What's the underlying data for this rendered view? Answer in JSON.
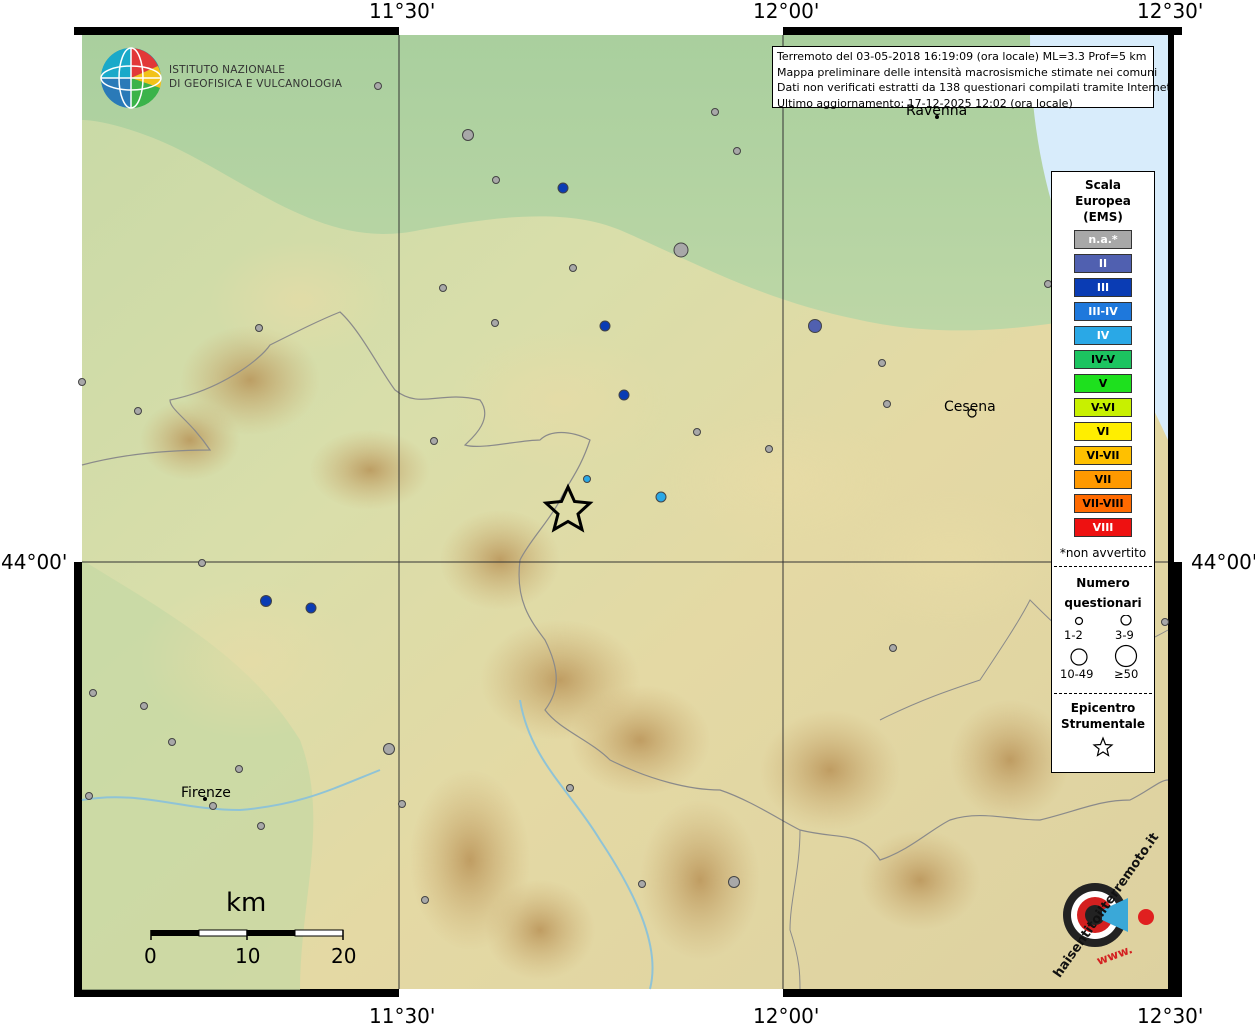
{
  "colors": {
    "border": "#000000",
    "grid": "#222222",
    "na": "#a8a8a8",
    "II": "#5060b0",
    "III": "#0a3cb4",
    "III_IV": "#1e78dc",
    "IV": "#2aa8e6",
    "IV_V": "#1cc460",
    "V": "#1ee01e",
    "V_VI": "#c8f000",
    "VI": "#ffee00",
    "VI_VII": "#ffc000",
    "VII": "#ff9900",
    "VII_VIII": "#ff6a00",
    "VIII": "#ee1111",
    "sea": "#d8ecfb"
  },
  "axes": {
    "top": [
      "11°30'",
      "12°00'",
      "12°30'"
    ],
    "bottom": [
      "11°30'",
      "12°00'",
      "12°30'"
    ],
    "left": "44°00'",
    "right": "44°00'"
  },
  "institute": {
    "line1": "ISTITUTO NAZIONALE",
    "line2": "DI GEOFISICA E VULCANOLOGIA",
    "logo_icon": "ingv-globe-icon"
  },
  "info": {
    "line1": "Terremoto del 03-05-2018 16:19:09 (ora locale) ML=3.3 Prof=5 km",
    "line2": "Mappa preliminare delle intensità macrosismiche stimate nei comuni",
    "line3": "Dati non verificati estratti da 138 questionari compilati tramite Internet.",
    "line4": "Ultimo aggiornamento: 17-12-2025 12:02 (ora locale)"
  },
  "legend": {
    "title1": "Scala",
    "title2": "Europea",
    "title3": "(EMS)",
    "classes": [
      {
        "label": "n.a.*",
        "color": "#a8a8a8",
        "dark": false
      },
      {
        "label": "II",
        "color": "#5060b0",
        "dark": false
      },
      {
        "label": "III",
        "color": "#0a3cb4",
        "dark": false
      },
      {
        "label": "III-IV",
        "color": "#1e78dc",
        "dark": false
      },
      {
        "label": "IV",
        "color": "#2aa8e6",
        "dark": false
      },
      {
        "label": "IV-V",
        "color": "#1cc460",
        "dark": true
      },
      {
        "label": "V",
        "color": "#1ee01e",
        "dark": true
      },
      {
        "label": "V-VI",
        "color": "#c8f000",
        "dark": true
      },
      {
        "label": "VI",
        "color": "#ffee00",
        "dark": true
      },
      {
        "label": "VI-VII",
        "color": "#ffc000",
        "dark": true
      },
      {
        "label": "VII",
        "color": "#ff9900",
        "dark": true
      },
      {
        "label": "VII-VIII",
        "color": "#ff6a00",
        "dark": true
      },
      {
        "label": "VIII",
        "color": "#ee1111",
        "dark": false
      }
    ],
    "note": "*non avvertito",
    "numero": "Numero",
    "questionari": "questionari",
    "size_labels": [
      "1-2",
      "3-9",
      "10-49",
      "≥50"
    ],
    "epi1": "Epicentro",
    "epi2": "Strumentale"
  },
  "cities": {
    "ravenna": "Ravenna",
    "cesena": "Cesena",
    "firenze": "Firenze"
  },
  "scalebar": {
    "unit": "km",
    "ticks": [
      "0",
      "10",
      "20"
    ]
  },
  "brand": {
    "text": "haisentitoilterremoto.it",
    "www": "www.",
    "icon": "target-megaphone-icon"
  }
}
